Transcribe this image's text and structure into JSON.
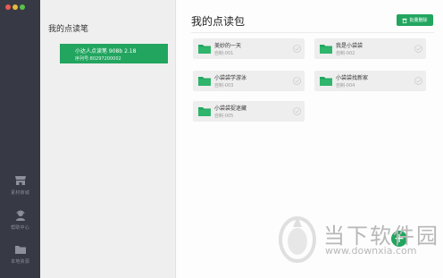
{
  "rail": {
    "items": [
      {
        "label": "素材商城",
        "icon": "store-icon"
      },
      {
        "label": "帮助中心",
        "icon": "support-agent-icon"
      },
      {
        "label": "本地资源",
        "icon": "folder-icon"
      }
    ]
  },
  "pen_panel": {
    "title": "我的点读笔",
    "pen": {
      "name": "小达人点读笔 908b 2.18",
      "serial": "序列号:80297200002"
    }
  },
  "main": {
    "title": "我的点读包",
    "bulk_delete_label": "批量删除",
    "packages": [
      {
        "name": "美妙的一天",
        "code": "自制-001"
      },
      {
        "name": "我是小袋袋",
        "code": "自制-002"
      },
      {
        "name": "小袋袋学游泳",
        "code": "自制-003"
      },
      {
        "name": "小袋袋找新家",
        "code": "自制-004"
      },
      {
        "name": "小袋袋捉迷藏",
        "code": "自制-005"
      }
    ],
    "fab_label": "+"
  },
  "watermark": {
    "name": "当下软件园",
    "url": "www.downxia.com"
  },
  "colors": {
    "accent": "#22a55f",
    "rail": "#373a44",
    "panel": "#efefef",
    "card": "#eeeeee"
  }
}
